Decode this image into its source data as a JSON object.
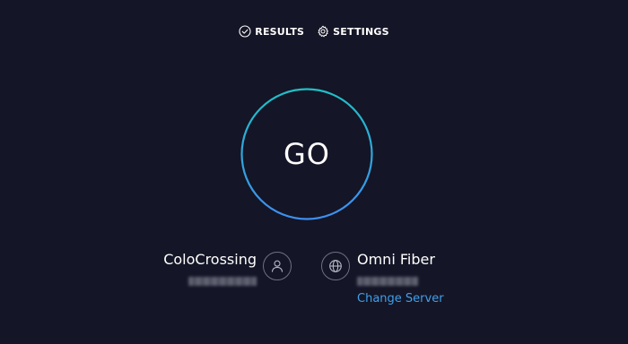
{
  "nav": {
    "results_label": "RESULTS",
    "results_icon": "check-circle-icon",
    "settings_label": "SETTINGS",
    "settings_icon": "gear-icon"
  },
  "go_button": {
    "label": "GO",
    "ring_color_start": "#1fc0c6",
    "ring_color_end": "#3f8ef0"
  },
  "isp": {
    "name": "ColoCrossing",
    "icon": "user-icon"
  },
  "server": {
    "name": "Omni Fiber",
    "icon": "globe-icon",
    "change_server_label": "Change Server"
  },
  "colors": {
    "background": "#141526",
    "text": "#ffffff",
    "link": "#3fa0ea",
    "icon_border": "#6f7184"
  }
}
